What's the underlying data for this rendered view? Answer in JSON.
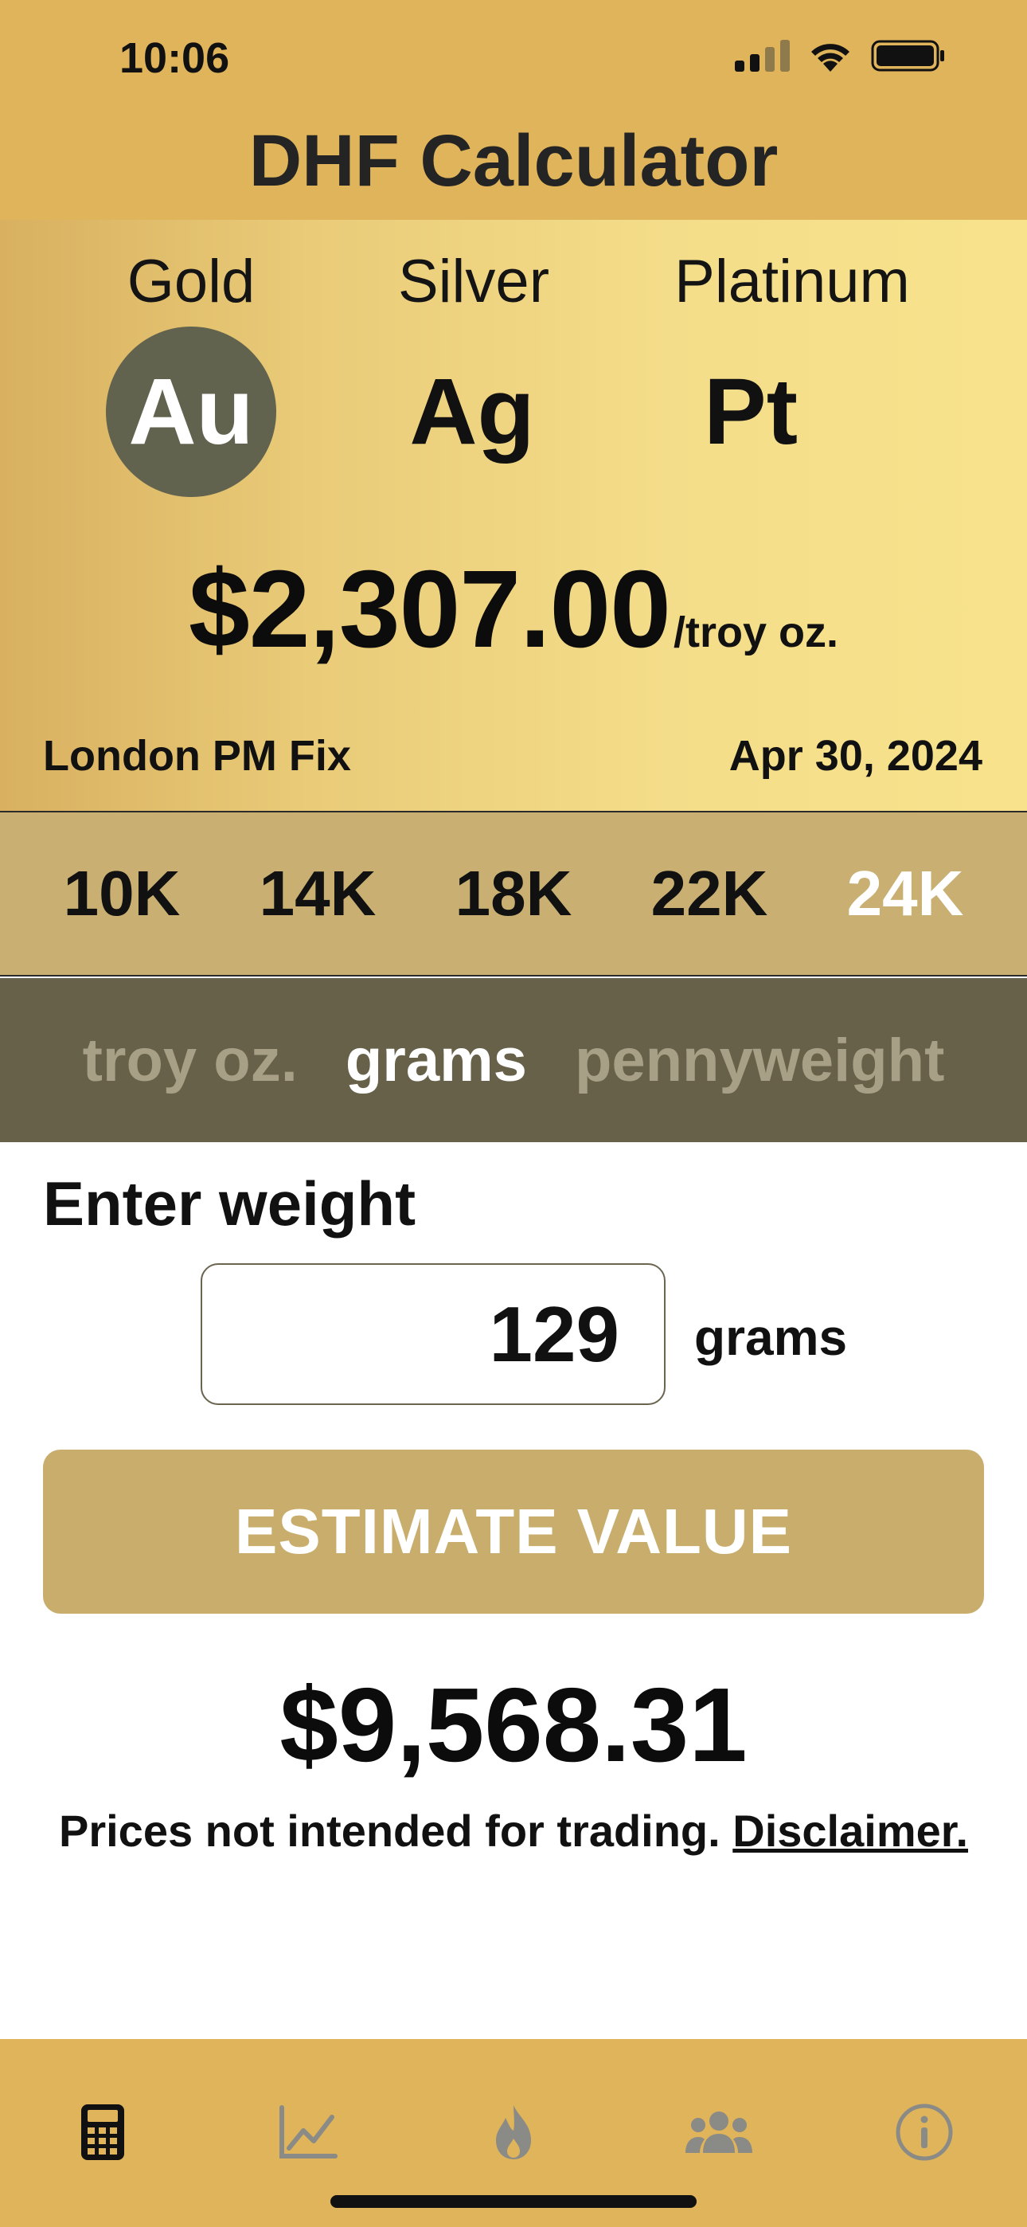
{
  "status_bar": {
    "time": "10:06",
    "icons": [
      "signal-icon",
      "wifi-icon",
      "battery-icon"
    ]
  },
  "header": {
    "title": "DHF Calculator"
  },
  "metals": [
    {
      "name": "Gold",
      "symbol": "Au",
      "selected": true
    },
    {
      "name": "Silver",
      "symbol": "Ag",
      "selected": false
    },
    {
      "name": "Platinum",
      "symbol": "Pt",
      "selected": false
    }
  ],
  "price": {
    "value": "$2,307.00",
    "unit": "/troy oz.",
    "source": "London PM Fix",
    "date": "Apr 30, 2024"
  },
  "karats": [
    "10K",
    "14K",
    "18K",
    "22K",
    "24K"
  ],
  "selected_karat": "24K",
  "units": [
    "troy oz.",
    "grams",
    "pennyweight"
  ],
  "selected_unit": "grams",
  "weight": {
    "label": "Enter weight",
    "value": "129",
    "unit": "grams"
  },
  "estimate_button": {
    "label": "ESTIMATE VALUE"
  },
  "result": {
    "value": "$9,568.31"
  },
  "disclaimer": {
    "text": "Prices not intended for trading.",
    "link": "Disclaimer."
  },
  "tabs": [
    {
      "icon": "calculator-icon",
      "active": true
    },
    {
      "icon": "chart-icon",
      "active": false
    },
    {
      "icon": "flame-icon",
      "active": false
    },
    {
      "icon": "people-icon",
      "active": false
    },
    {
      "icon": "info-icon",
      "active": false
    }
  ],
  "colors": {
    "header_bg": "#dfb45a",
    "selected_metal": "#62634f",
    "karat_bg": "#c9b072",
    "unit_bg": "#67614a",
    "button_bg": "#c8ad6c"
  }
}
